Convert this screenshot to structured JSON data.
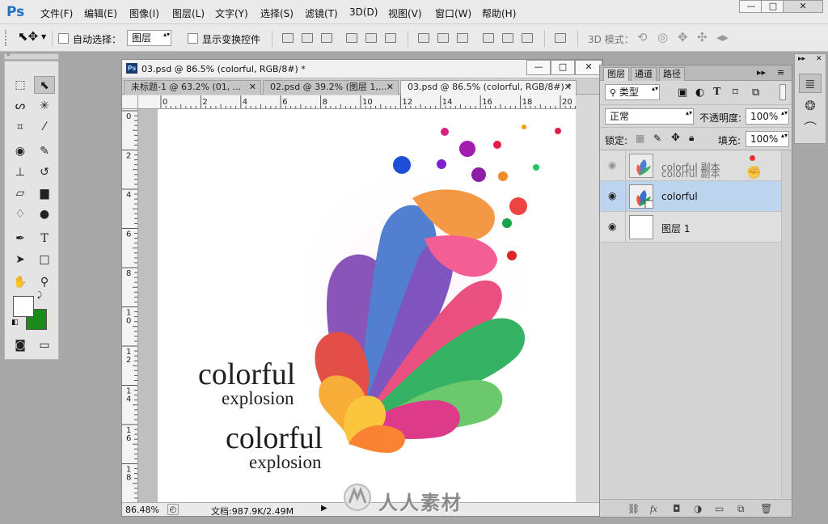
{
  "app": {
    "logo": "Ps"
  },
  "menu": [
    "文件(F)",
    "编辑(E)",
    "图像(I)",
    "图层(L)",
    "文字(Y)",
    "选择(S)",
    "滤镜(T)",
    "3D(D)",
    "视图(V)",
    "窗口(W)",
    "帮助(H)"
  ],
  "window_controls": {
    "minimize": "—",
    "maximize": "□",
    "close": "✕"
  },
  "options": {
    "auto_select_label": "自动选择：",
    "auto_select_checked": false,
    "auto_select_value": "图层",
    "show_transform_label": "显示变换控件",
    "show_transform_checked": false,
    "mode_3d_label": "3D 模式："
  },
  "document": {
    "title": "03.psd @ 86.5% (colorful, RGB/8#) *",
    "icon_text": "Ps",
    "tabs": [
      {
        "label": "未标题-1 @ 63.2% (01, ..."
      },
      {
        "label": "02.psd @ 39.2% (图层 1,..."
      },
      {
        "label": "03.psd @ 86.5% (colorful, RGB/8#) *"
      }
    ],
    "ruler_h": [
      "0",
      "2",
      "4",
      "6",
      "8",
      "10",
      "12",
      "14",
      "16",
      "18",
      "20"
    ],
    "ruler_v": [
      "0",
      "2",
      "4",
      "6",
      "8",
      "10",
      "12",
      "14",
      "16",
      "18"
    ],
    "artwork": {
      "line1_main": "colorful",
      "line1_sub": "explosion",
      "line2_main": "colorful",
      "line2_sub": "explosion"
    },
    "zoom": "86.48%",
    "doc_info": "文档:987.9K/2.49M"
  },
  "layers_panel": {
    "tabs": [
      "图层",
      "通道",
      "路径"
    ],
    "kind_filter": "类型",
    "blend_mode": "正常",
    "opacity_label": "不透明度:",
    "opacity_value": "100%",
    "lock_label": "锁定:",
    "fill_label": "填充:",
    "fill_value": "100%",
    "layers": [
      {
        "name": "colorful 副本",
        "visible": true,
        "selected": false,
        "dragging": true
      },
      {
        "name": "colorful",
        "visible": true,
        "selected": true,
        "dragging": false
      },
      {
        "name": "图层 1",
        "visible": true,
        "selected": false,
        "dragging": false
      }
    ]
  },
  "watermark": "人人素材",
  "colors": {
    "accent": "#1f6fc4",
    "foreground_swatch": "#ffffff",
    "background_swatch": "#1a8a1a",
    "selected_layer": "#bcd4ee"
  }
}
